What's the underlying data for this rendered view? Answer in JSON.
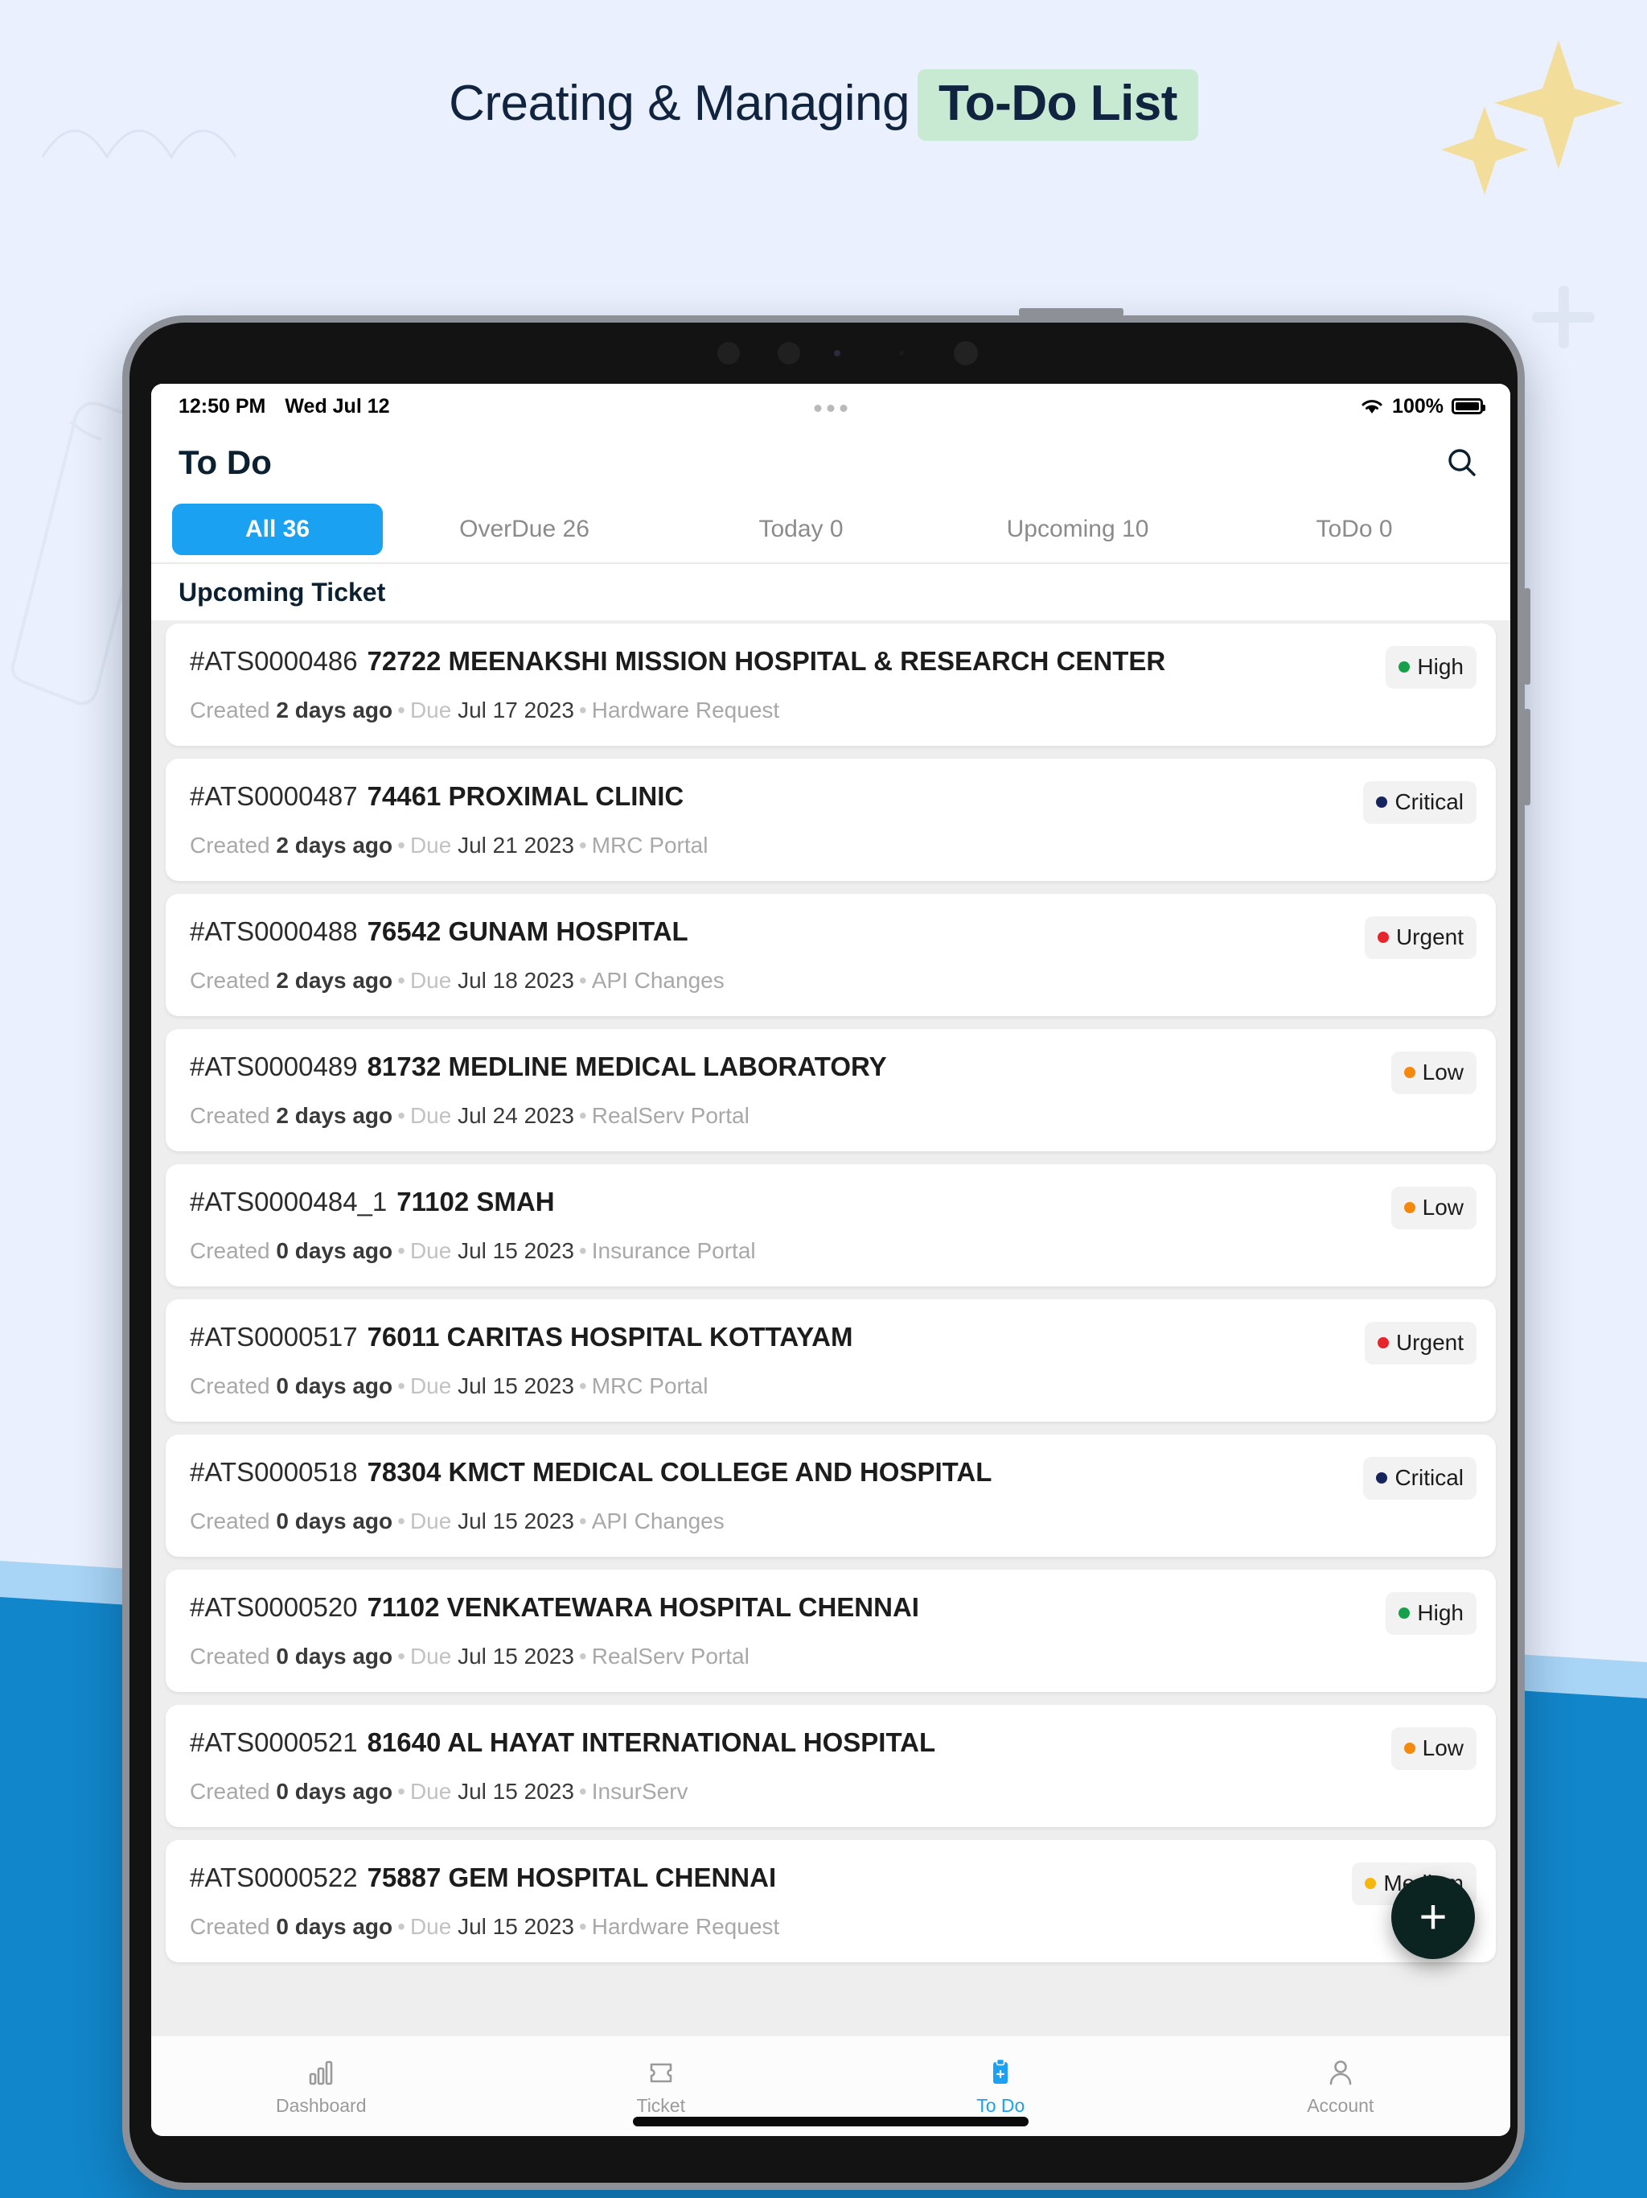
{
  "headline": {
    "plain": "Creating & Managing",
    "highlight": "To-Do List",
    "highlight_bg": "#c8ead2"
  },
  "status_bar": {
    "time": "12:50 PM",
    "date": "Wed Jul 12",
    "battery_percent": "100%",
    "wifi_icon": "wifi-icon",
    "battery_icon": "battery-icon"
  },
  "app_header": {
    "title": "To Do",
    "search_icon": "search-icon"
  },
  "tabs": [
    {
      "label": "All 36",
      "active": true
    },
    {
      "label": "OverDue 26",
      "active": false
    },
    {
      "label": "Today 0",
      "active": false
    },
    {
      "label": "Upcoming 10",
      "active": false
    },
    {
      "label": "ToDo 0",
      "active": false
    }
  ],
  "section_label": "Upcoming Ticket",
  "meta_labels": {
    "created": "Created",
    "due": "Due",
    "separator": "•"
  },
  "priority_colors": {
    "High": "#17a04a",
    "Critical": "#17255e",
    "Urgent": "#e8252a",
    "Low": "#f5890d",
    "Medium": "#f5b60d"
  },
  "accent_color": "#1ba1f2",
  "tickets": [
    {
      "id": "#ATS0000486",
      "name": "72722 MEENAKSHI MISSION HOSPITAL & RESEARCH CENTER",
      "created": "2 days ago",
      "due": "Jul 17 2023",
      "category": "Hardware Request",
      "priority": "High"
    },
    {
      "id": "#ATS0000487",
      "name": "74461 PROXIMAL CLINIC",
      "created": "2 days ago",
      "due": "Jul 21 2023",
      "category": "MRC Portal",
      "priority": "Critical"
    },
    {
      "id": "#ATS0000488",
      "name": "76542 GUNAM HOSPITAL",
      "created": "2 days ago",
      "due": "Jul 18 2023",
      "category": "API Changes",
      "priority": "Urgent"
    },
    {
      "id": "#ATS0000489",
      "name": "81732 MEDLINE MEDICAL LABORATORY",
      "created": "2 days ago",
      "due": "Jul 24 2023",
      "category": "RealServ Portal",
      "priority": "Low"
    },
    {
      "id": "#ATS0000484_1",
      "name": "71102 SMAH",
      "created": "0 days ago",
      "due": "Jul 15 2023",
      "category": "Insurance Portal",
      "priority": "Low"
    },
    {
      "id": "#ATS0000517",
      "name": "76011 CARITAS HOSPITAL KOTTAYAM",
      "created": "0 days ago",
      "due": "Jul 15 2023",
      "category": "MRC Portal",
      "priority": "Urgent"
    },
    {
      "id": "#ATS0000518",
      "name": "78304 KMCT MEDICAL COLLEGE AND HOSPITAL",
      "created": "0 days ago",
      "due": "Jul 15 2023",
      "category": "API Changes",
      "priority": "Critical"
    },
    {
      "id": "#ATS0000520",
      "name": "71102 VENKATEWARA HOSPITAL CHENNAI",
      "created": "0 days ago",
      "due": "Jul 15 2023",
      "category": "RealServ Portal",
      "priority": "High"
    },
    {
      "id": "#ATS0000521",
      "name": "81640 AL HAYAT INTERNATIONAL HOSPITAL",
      "created": "0 days ago",
      "due": "Jul 15 2023",
      "category": "InsurServ",
      "priority": "Low"
    },
    {
      "id": "#ATS0000522",
      "name": "75887 GEM HOSPITAL CHENNAI",
      "created": "0 days ago",
      "due": "Jul 15 2023",
      "category": "Hardware Request",
      "priority": "Medium"
    }
  ],
  "fab": {
    "label": "+",
    "icon": "plus-icon"
  },
  "bottom_nav": [
    {
      "label": "Dashboard",
      "icon": "bar-chart-icon",
      "active": false
    },
    {
      "label": "Ticket",
      "icon": "ticket-icon",
      "active": false
    },
    {
      "label": "To Do",
      "icon": "clipboard-check-icon",
      "active": true
    },
    {
      "label": "Account",
      "icon": "person-icon",
      "active": false
    }
  ]
}
